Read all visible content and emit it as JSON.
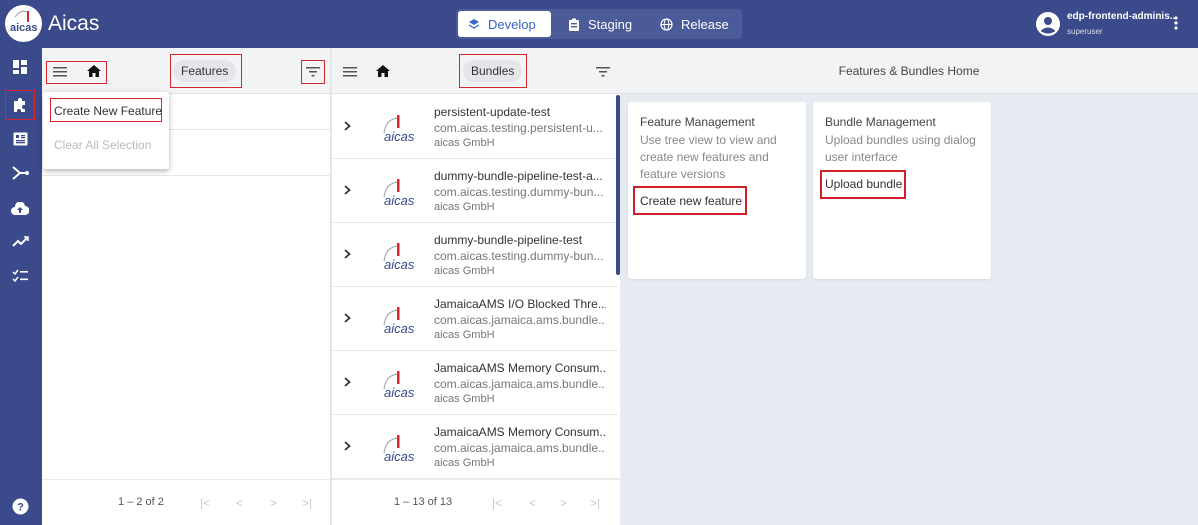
{
  "app": {
    "title": "Aicas",
    "logo_text": "aicas"
  },
  "env_tabs": [
    {
      "label": "Develop",
      "active": true,
      "icon": "layers-icon"
    },
    {
      "label": "Staging",
      "active": false,
      "icon": "clipboard-icon"
    },
    {
      "label": "Release",
      "active": false,
      "icon": "globe-icon"
    }
  ],
  "user": {
    "name": "edp-frontend-adminis...",
    "role": "superuser"
  },
  "sidebar": {
    "items": [
      {
        "icon": "dashboard-icon"
      },
      {
        "icon": "puzzle-icon",
        "active": true
      },
      {
        "icon": "bundle-icon"
      },
      {
        "icon": "pipeline-icon"
      },
      {
        "icon": "cloud-upload-icon"
      },
      {
        "icon": "trending-icon"
      },
      {
        "icon": "checklist-icon"
      },
      {
        "icon": "help-icon"
      }
    ]
  },
  "features": {
    "header_label": "Features",
    "menu": {
      "create": "Create New Feature",
      "clear": "Clear All Selection"
    },
    "range": "1 – 2 of 2"
  },
  "bundles": {
    "header_label": "Bundles",
    "range": "1 – 13 of 13",
    "items": [
      {
        "title": "persistent-update-test",
        "id": "com.aicas.testing.persistent-u...",
        "vendor": "aicas GmbH"
      },
      {
        "title": "dummy-bundle-pipeline-test-a...",
        "id": "com.aicas.testing.dummy-bun...",
        "vendor": "aicas GmbH"
      },
      {
        "title": "dummy-bundle-pipeline-test",
        "id": "com.aicas.testing.dummy-bun...",
        "vendor": "aicas GmbH"
      },
      {
        "title": "JamaicaAMS I/O Blocked Thre...",
        "id": "com.aicas.jamaica.ams.bundle....",
        "vendor": "aicas GmbH"
      },
      {
        "title": "JamaicaAMS Memory Consum...",
        "id": "com.aicas.jamaica.ams.bundle....",
        "vendor": "aicas GmbH"
      },
      {
        "title": "JamaicaAMS Memory Consum...",
        "id": "com.aicas.jamaica.ams.bundle....",
        "vendor": "aicas GmbH"
      }
    ]
  },
  "home": {
    "title": "Features & Bundles Home",
    "feature_card": {
      "title": "Feature Management",
      "desc1": "Use tree view to view and",
      "desc2": "create new features and",
      "desc3": "feature versions",
      "action": "Create new feature"
    },
    "bundle_card": {
      "title": "Bundle Management",
      "desc1": "Upload bundles using dialog",
      "desc2": "user interface",
      "action": "Upload bundle"
    }
  },
  "colors": {
    "primary": "#3a4a8a",
    "highlight": "#d9252f",
    "accent": "#3a66c8"
  }
}
